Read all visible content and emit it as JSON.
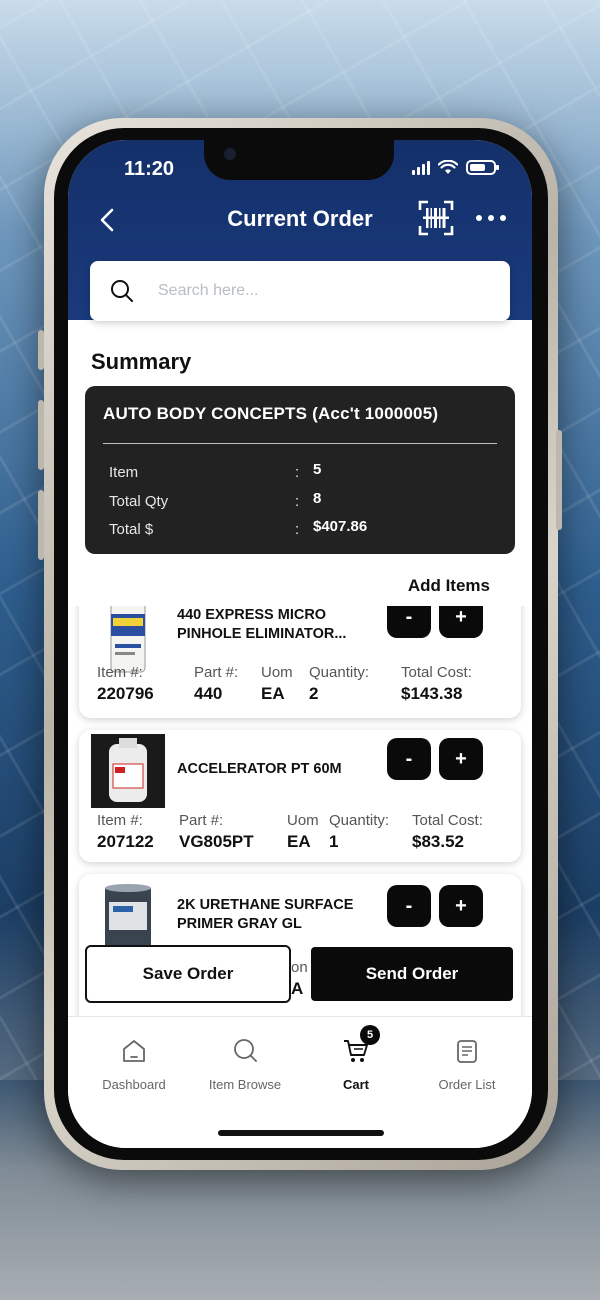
{
  "status_bar": {
    "time": "11:20"
  },
  "header": {
    "title": "Current Order"
  },
  "search": {
    "placeholder": "Search here..."
  },
  "summary": {
    "heading": "Summary",
    "account": "AUTO BODY CONCEPTS (Acc't 1000005)",
    "rows": [
      {
        "label": "Item",
        "colon": ":",
        "value": "5"
      },
      {
        "label": "Total Qty",
        "colon": ":",
        "value": "8"
      },
      {
        "label": "Total $",
        "colon": ":",
        "value": "$407.86"
      }
    ]
  },
  "add_items_label": "Add Items",
  "items": [
    {
      "name_line1": "440 EXPRESS MICRO",
      "name_line2": "PINHOLE ELIMINATOR...",
      "item_label": "Item #:",
      "item_value": "220796",
      "part_label": "Part #:",
      "part_value": "440",
      "uom_label": "Uom",
      "uom_value": "EA",
      "qty_label": "Quantity:",
      "qty_value": "2",
      "cost_label": "Total Cost:",
      "cost_value": "$143.38",
      "minus": "-",
      "plus": "+"
    },
    {
      "name_line1": "ACCELERATOR PT 60M",
      "item_label": "Item #:",
      "item_value": "207122",
      "part_label": "Part #:",
      "part_value": "VG805PT",
      "uom_label": "Uom",
      "uom_value": "EA",
      "qty_label": "Quantity:",
      "qty_value": "1",
      "cost_label": "Total Cost:",
      "cost_value": "$83.52",
      "minus": "-",
      "plus": "+"
    },
    {
      "name_line1": "2K URETHANE SURFACE",
      "name_line2": "PRIMER GRAY GL",
      "partial_label": "on",
      "partial_value": "A",
      "minus": "-",
      "plus": "+"
    }
  ],
  "actions": {
    "save": "Save Order",
    "send": "Send Order"
  },
  "tabs": [
    {
      "label": "Dashboard",
      "icon": "home-icon"
    },
    {
      "label": "Item Browse",
      "icon": "search-icon"
    },
    {
      "label": "Cart",
      "icon": "cart-icon",
      "badge": "5",
      "active": true
    },
    {
      "label": "Order List",
      "icon": "order-list-icon"
    }
  ],
  "colors": {
    "header": "#14306a",
    "card_dark": "#222222",
    "button": "#0a0a0a"
  }
}
